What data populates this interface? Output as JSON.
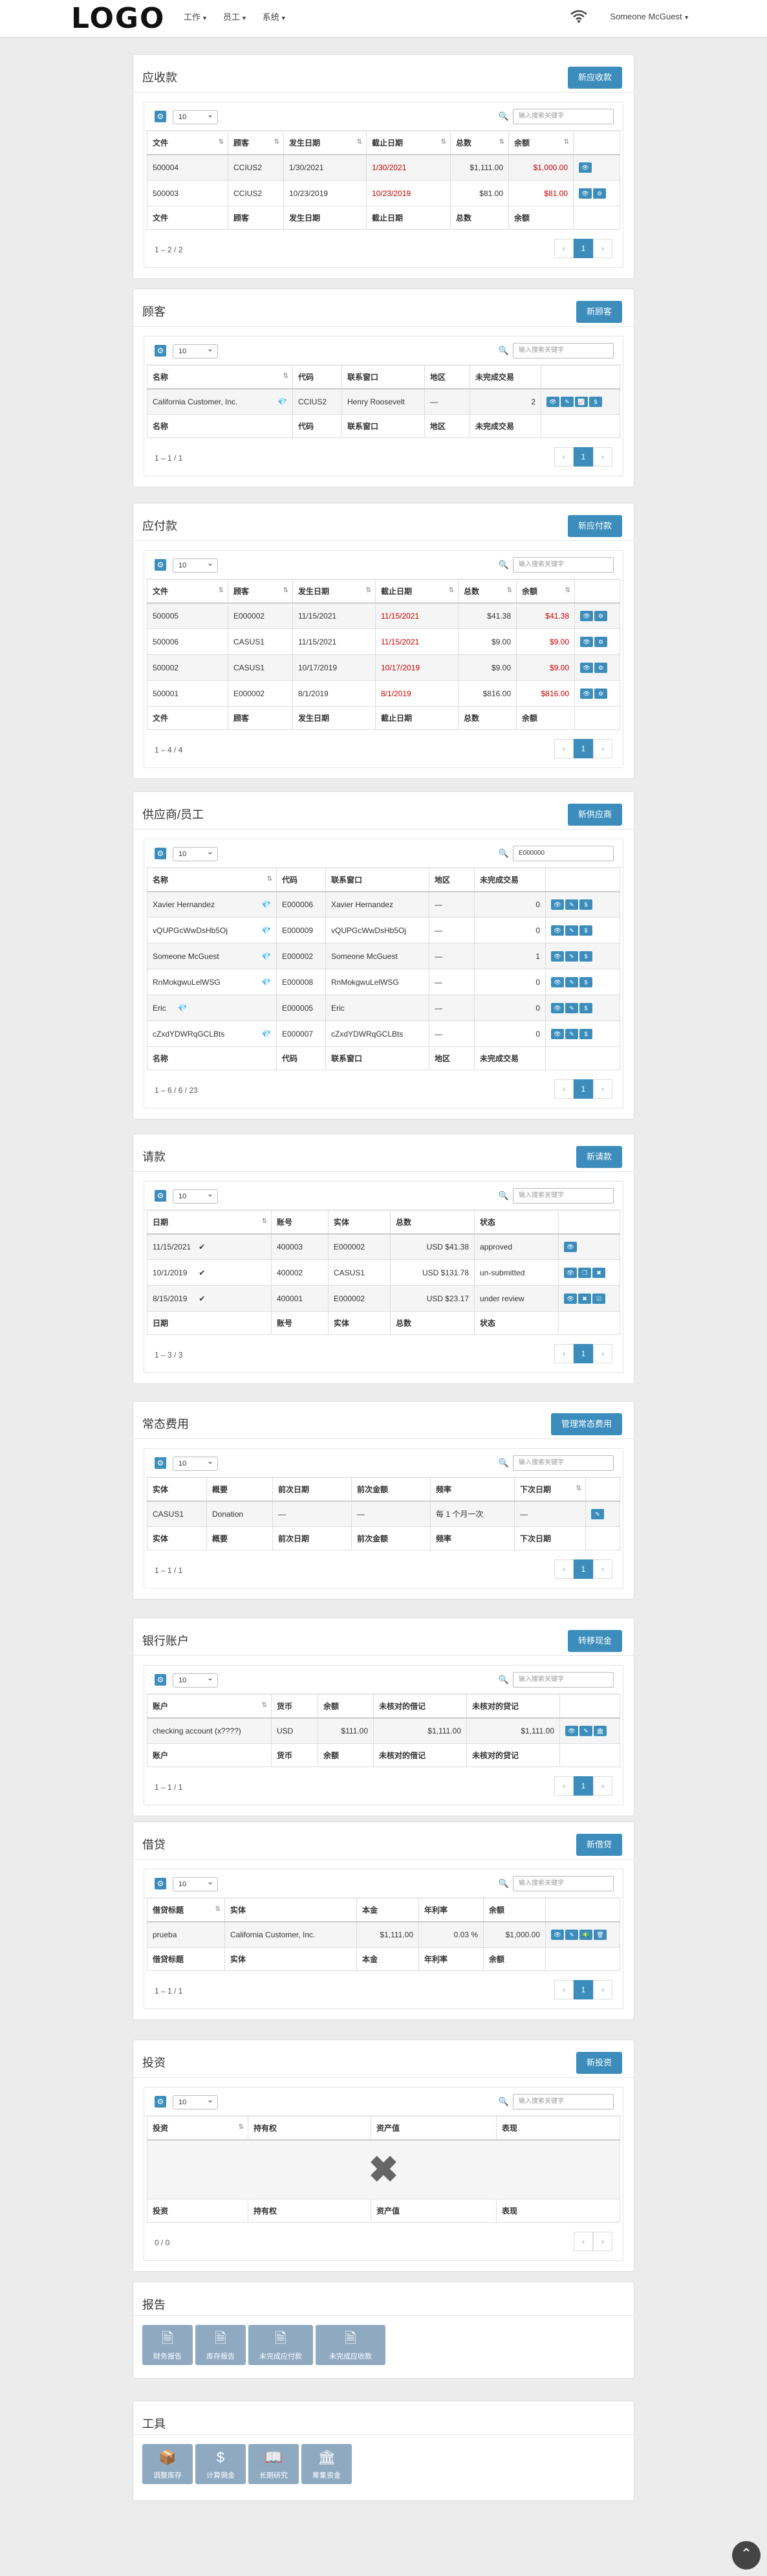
{
  "header": {
    "logo": "LOGO",
    "nav": [
      "工作",
      "员工",
      "系统"
    ],
    "user": "Someone McGuest"
  },
  "receivables": {
    "title": "应收款",
    "new_label": "新应收款",
    "page_size": "10",
    "search_placeholder": "输入搜索关键字",
    "columns": [
      "文件",
      "顾客",
      "发生日期",
      "截止日期",
      "总数",
      "余额",
      ""
    ],
    "rows": [
      [
        "500004",
        "CCIUS2",
        "1/30/2021",
        "1/30/2021",
        "$1,111.00",
        "$1,000.00"
      ],
      [
        "500003",
        "CCIUS2",
        "10/23/2019",
        "10/23/2019",
        "$81.00",
        "$81.00"
      ]
    ],
    "info": "1 – 2 / 2",
    "page": "1"
  },
  "customers": {
    "title": "顾客",
    "new_label": "新顾客",
    "page_size": "10",
    "search_placeholder": "输入搜索关键字",
    "columns": [
      "名称",
      "代码",
      "联系窗口",
      "地区",
      "未完成交易",
      ""
    ],
    "rows": [
      [
        "California Customer, Inc.",
        "CCIUS2",
        "Henry Roosevelt",
        "—",
        "2"
      ]
    ],
    "info": "1 – 1 / 1",
    "page": "1"
  },
  "payables": {
    "title": "应付款",
    "new_label": "新应付款",
    "page_size": "10",
    "search_placeholder": "输入搜索关键字",
    "columns": [
      "文件",
      "顾客",
      "发生日期",
      "截止日期",
      "总数",
      "余额",
      ""
    ],
    "rows": [
      [
        "500005",
        "E000002",
        "11/15/2021",
        "11/15/2021",
        "$41.38",
        "$41.38"
      ],
      [
        "500006",
        "CASUS1",
        "11/15/2021",
        "11/15/2021",
        "$9.00",
        "$9.00"
      ],
      [
        "500002",
        "CASUS1",
        "10/17/2019",
        "10/17/2019",
        "$9.00",
        "$9.00"
      ],
      [
        "500001",
        "E000002",
        "8/1/2019",
        "8/1/2019",
        "$816.00",
        "$816.00"
      ]
    ],
    "info": "1 – 4 / 4",
    "page": "1"
  },
  "vendors": {
    "title": "供应商/员工",
    "new_label": "新供应商",
    "page_size": "10",
    "search_value": "E000000",
    "columns": [
      "名称",
      "代码",
      "联系窗口",
      "地区",
      "未完成交易",
      ""
    ],
    "rows": [
      [
        "Xavier Hernandez",
        "E000006",
        "Xavier Hernandez",
        "—",
        "0"
      ],
      [
        "vQUPGcWwDsHb5Oj",
        "E000009",
        "vQUPGcWwDsHb5Oj",
        "—",
        "0"
      ],
      [
        "Someone McGuest",
        "E000002",
        "Someone McGuest",
        "—",
        "1"
      ],
      [
        "RnMokgwuLelWSG",
        "E000008",
        "RnMokgwuLelWSG",
        "—",
        "0"
      ],
      [
        "Eric",
        "E000005",
        "Eric",
        "—",
        "0"
      ],
      [
        "cZxdYDWRqGCLBts",
        "E000007",
        "cZxdYDWRqGCLBts",
        "—",
        "0"
      ]
    ],
    "info": "1 – 6 / 6 / 23",
    "page": "1"
  },
  "claims": {
    "title": "请款",
    "new_label": "新请款",
    "page_size": "10",
    "search_placeholder": "输入搜索关键字",
    "columns": [
      "日期",
      "账号",
      "实体",
      "总数",
      "状态",
      ""
    ],
    "rows": [
      [
        "11/15/2021",
        "400003",
        "E000002",
        "USD $41.38",
        "approved"
      ],
      [
        "10/1/2019",
        "400002",
        "CASUS1",
        "USD $131.78",
        "un-submitted"
      ],
      [
        "8/15/2019",
        "400001",
        "E000002",
        "USD $23.17",
        "under review"
      ]
    ],
    "info": "1 – 3 / 3",
    "page": "1"
  },
  "recurring": {
    "title": "常态费用",
    "new_label": "管理常态费用",
    "page_size": "10",
    "search_placeholder": "输入搜索关键字",
    "columns": [
      "实体",
      "概要",
      "前次日期",
      "前次金额",
      "频率",
      "下次日期",
      ""
    ],
    "rows": [
      [
        "CASUS1",
        "Donation",
        "—",
        "—",
        "每 1 个月一次",
        "—"
      ]
    ],
    "info": "1 – 1 / 1",
    "page": "1"
  },
  "bank": {
    "title": "银行账户",
    "new_label": "转移现金",
    "page_size": "10",
    "search_placeholder": "输入搜索关键字",
    "columns": [
      "账户",
      "货币",
      "余额",
      "未核对的借记",
      "未核对的贷记",
      ""
    ],
    "rows": [
      [
        "checking account (x????)",
        "USD",
        "$111.00",
        "$1,111.00",
        "$1,111.00"
      ]
    ],
    "info": "1 – 1 / 1",
    "page": "1"
  },
  "loans": {
    "title": "借贷",
    "new_label": "新借贷",
    "page_size": "10",
    "search_placeholder": "输入搜索关键字",
    "columns": [
      "借贷标题",
      "实体",
      "本金",
      "年利率",
      "余额",
      ""
    ],
    "rows": [
      [
        "prueba",
        "California Customer, Inc.",
        "$1,111.00",
        "0.03 %",
        "$1,000.00"
      ]
    ],
    "info": "1 – 1 / 1",
    "page": "1"
  },
  "investments": {
    "title": "投资",
    "new_label": "新投资",
    "page_size": "10",
    "search_placeholder": "输入搜索关键字",
    "columns": [
      "投资",
      "持有权",
      "资产值",
      "表现"
    ],
    "info": "0 / 0"
  },
  "reports": {
    "title": "报告",
    "tiles": [
      "财务报告",
      "库存报告",
      "未完成应付款",
      "未完成应收款"
    ]
  },
  "tools": {
    "title": "工具",
    "tiles": [
      "调整库存",
      "计算佣金",
      "长期研究",
      "筹集资金"
    ]
  }
}
